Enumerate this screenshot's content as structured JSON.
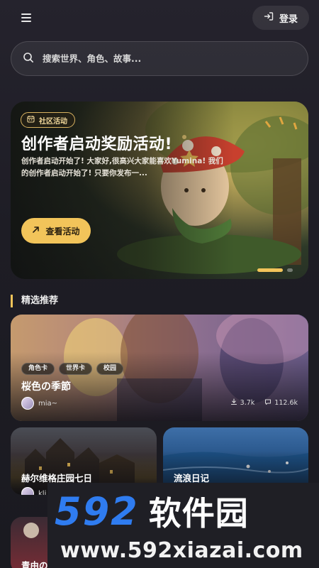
{
  "header": {
    "menu_icon": "hamburger-menu-icon",
    "login_label": "登录",
    "login_icon": "login-arrow-icon"
  },
  "search": {
    "placeholder": "搜索世界、角色、故事...",
    "icon": "search-icon"
  },
  "banner": {
    "badge_label": "社区活动",
    "badge_icon": "calendar-icon",
    "title": "创作者启动奖励活动!",
    "description": "创作者启动开始了!  大家好,很高兴大家能喜欢Yumina! 我们的创作者启动开始了!  只要你发布一...",
    "cta_label": "查看活动",
    "cta_icon": "arrow-up-right-icon",
    "slides_total": 2,
    "slide_active": 1
  },
  "featured": {
    "section_title": "精选推荐",
    "accent_color": "#f2c45a",
    "main_card": {
      "tags": [
        "角色卡",
        "世界卡",
        "校园"
      ],
      "title": "桜色の季節",
      "author": "mia~",
      "downloads": "3.7k",
      "views": "112.6k"
    },
    "cards": [
      {
        "title": "赫尔维格庄园七日",
        "author": "klj"
      },
      {
        "title": "流浪日记",
        "author": ""
      },
      {
        "title": "青由の",
        "author": ""
      }
    ]
  },
  "watermark": {
    "number": "592",
    "name": "软件园",
    "url": "www.592xiazai.com",
    "brand_color": "#2f7cf0"
  }
}
